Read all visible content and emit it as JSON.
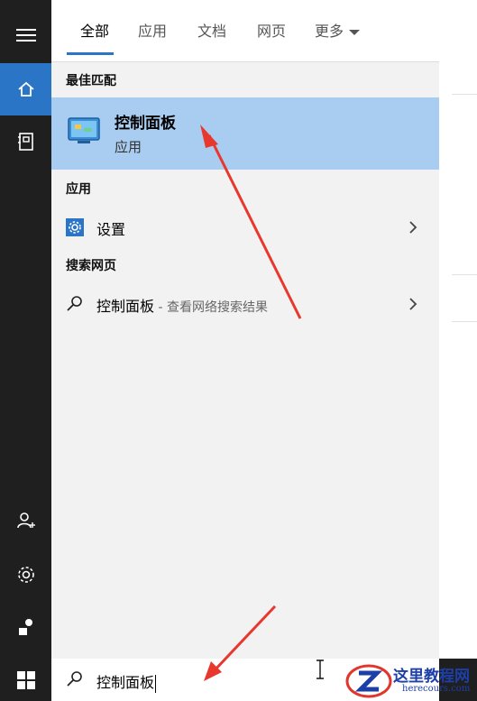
{
  "tabs": [
    {
      "label": "全部",
      "active": true
    },
    {
      "label": "应用",
      "active": false
    },
    {
      "label": "文档",
      "active": false
    },
    {
      "label": "网页",
      "active": false
    },
    {
      "label": "更多",
      "active": false
    }
  ],
  "sections": {
    "best_match": "最佳匹配",
    "apps": "应用",
    "web": "搜索网页"
  },
  "best_match_item": {
    "title": "控制面板",
    "subtitle": "应用",
    "icon": "control-panel-icon"
  },
  "app_items": [
    {
      "label": "设置",
      "icon": "settings-gear-icon"
    }
  ],
  "web_items": [
    {
      "label": "控制面板",
      "suffix": " - 查看网络搜索结果",
      "icon": "search-icon"
    }
  ],
  "search": {
    "value": "控制面板"
  },
  "rail_icons": [
    "hamburger-menu-icon",
    "home-icon",
    "notebook-icon",
    "user-add-icon",
    "gear-icon",
    "feedback-icon"
  ],
  "watermark": {
    "title": "这里教程网",
    "url": "herecours.com"
  },
  "colors": {
    "accent": "#2b75c7",
    "selection": "#a9cdf0",
    "rail": "#1f1f1f",
    "arrow": "#e8382e"
  }
}
